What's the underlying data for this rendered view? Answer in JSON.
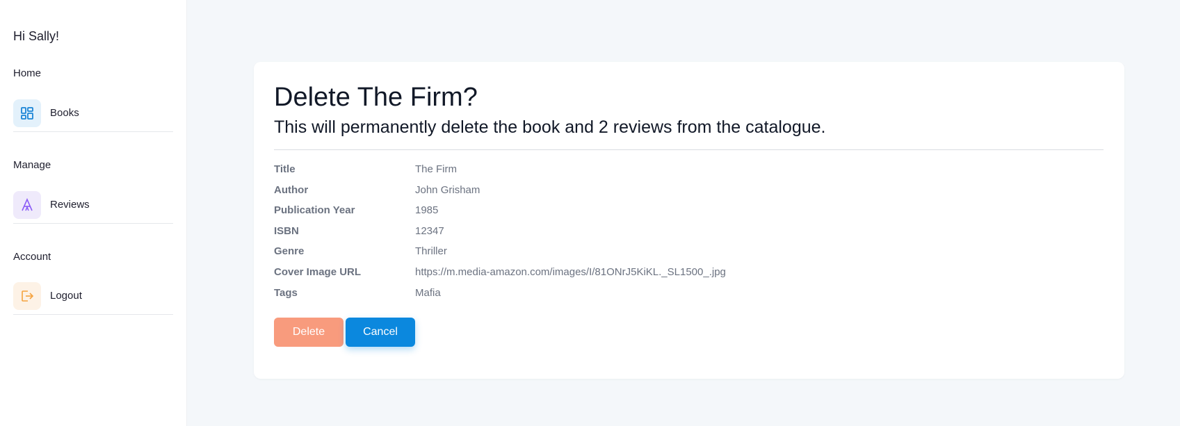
{
  "sidebar": {
    "greeting": "Hi Sally!",
    "sections": [
      {
        "title": "Home",
        "item": {
          "label": "Books",
          "icon": "dashboard-grid-icon",
          "color": "#1a84d6"
        }
      },
      {
        "title": "Manage",
        "item": {
          "label": "Reviews",
          "icon": "font-letter-a-icon",
          "color": "#8b5cf6"
        }
      },
      {
        "title": "Account",
        "item": {
          "label": "Logout",
          "icon": "logout-icon",
          "color": "#f5a23d"
        }
      }
    ]
  },
  "dialog": {
    "title": "Delete The Firm?",
    "subtitle": "This will permanently delete the book and 2 reviews from the catalogue.",
    "details": [
      {
        "label": "Title",
        "value": "The Firm"
      },
      {
        "label": "Author",
        "value": "John Grisham"
      },
      {
        "label": "Publication Year",
        "value": "1985"
      },
      {
        "label": "ISBN",
        "value": "12347"
      },
      {
        "label": "Genre",
        "value": "Thriller"
      },
      {
        "label": "Cover Image URL",
        "value": "https://m.media-amazon.com/images/I/81ONrJ5KiKL._SL1500_.jpg"
      },
      {
        "label": "Tags",
        "value": "Mafia"
      }
    ],
    "delete_label": "Delete",
    "cancel_label": "Cancel"
  },
  "colors": {
    "background": "#f4f7fa",
    "delete_button": "#f89b7d",
    "cancel_button": "#0b88de"
  }
}
